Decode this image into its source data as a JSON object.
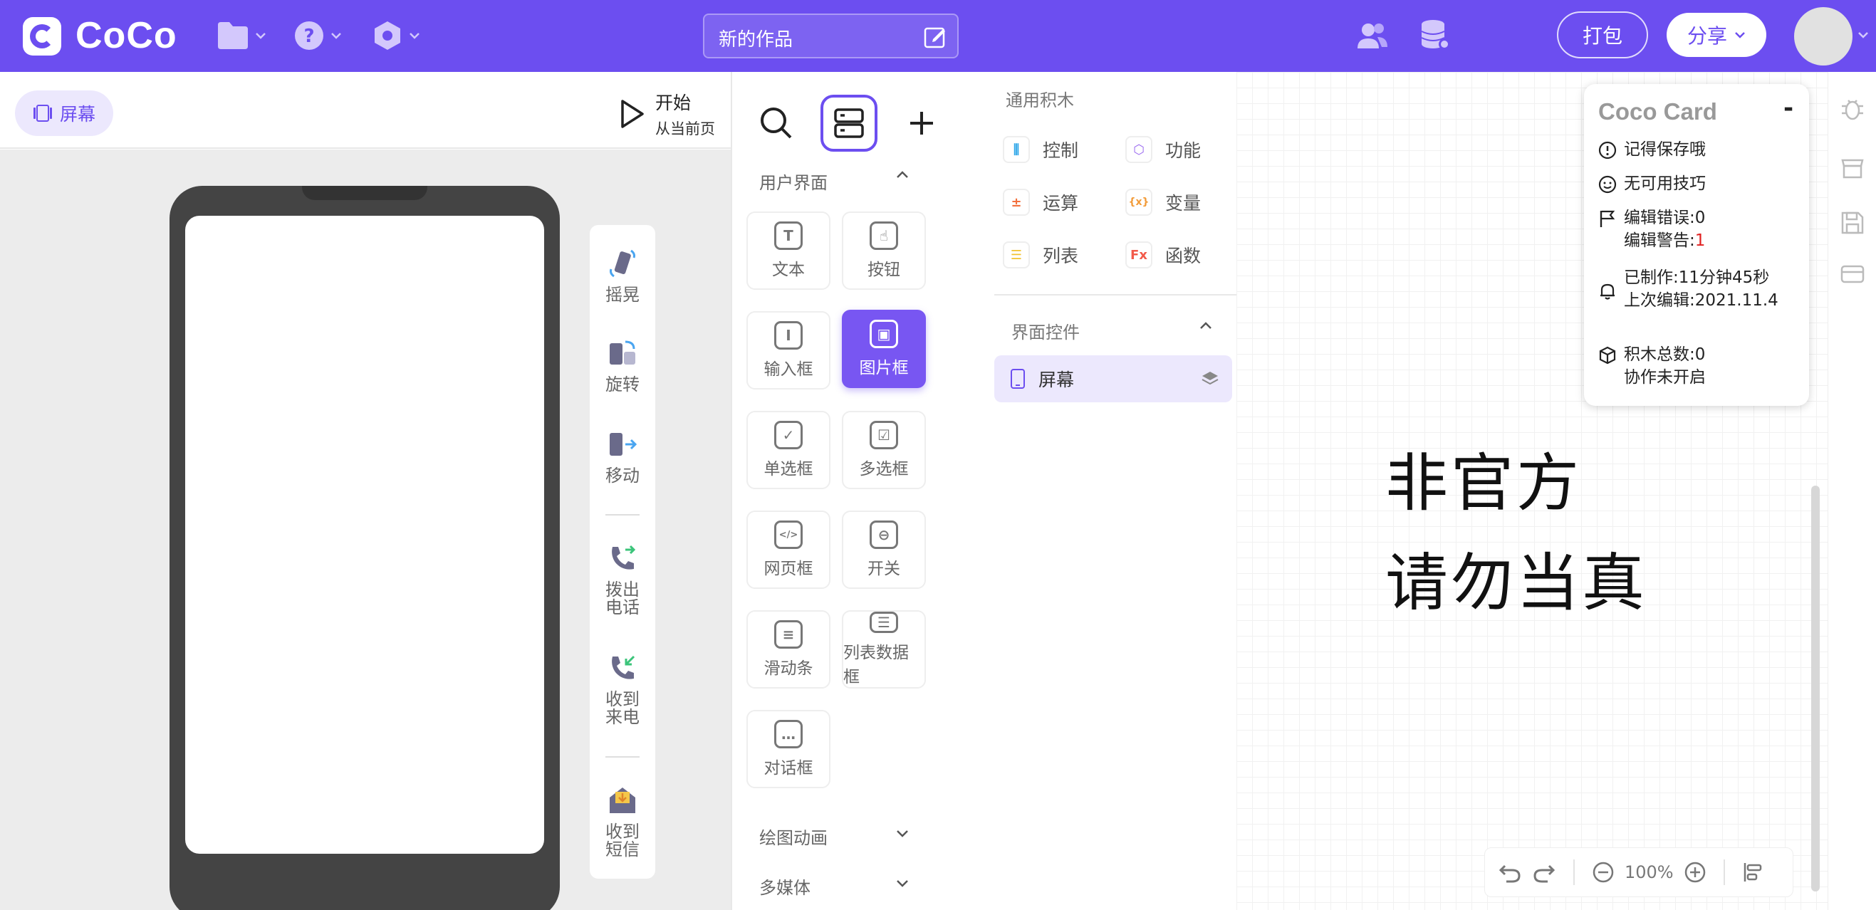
{
  "app": {
    "name": "CoCo"
  },
  "header": {
    "project_title": "新的作品",
    "pack_label": "打包",
    "share_label": "分享",
    "menus": [
      "file-icon",
      "help-icon",
      "settings-icon"
    ]
  },
  "stage": {
    "screen_tab": "屏幕",
    "start_label": "开始",
    "start_sub": "从当前页"
  },
  "sensors": [
    {
      "icon": "shake-icon",
      "label": "摇晃"
    },
    {
      "icon": "rotate-icon",
      "label": "旋转"
    },
    {
      "icon": "move-icon",
      "label": "移动"
    },
    {
      "icon": "call-out-icon",
      "label": "拨出电话"
    },
    {
      "icon": "call-in-icon",
      "label": "收到来电"
    },
    {
      "icon": "sms-icon",
      "label": "收到短信"
    }
  ],
  "components_panel": {
    "category_ui": "用户界面",
    "items": [
      {
        "label": "文本",
        "glyph": "T"
      },
      {
        "label": "按钮",
        "glyph": "☝"
      },
      {
        "label": "输入框",
        "glyph": "I"
      },
      {
        "label": "图片框",
        "glyph": "▣"
      },
      {
        "label": "单选框",
        "glyph": "✓"
      },
      {
        "label": "多选框",
        "glyph": "☑"
      },
      {
        "label": "网页框",
        "glyph": "</>"
      },
      {
        "label": "开关",
        "glyph": "⊖"
      },
      {
        "label": "滑动条",
        "glyph": "≡"
      },
      {
        "label": "列表数据框",
        "glyph": "☰"
      },
      {
        "label": "对话框",
        "glyph": "…"
      }
    ],
    "category_draw": "绘图动画",
    "category_media": "多媒体"
  },
  "blocks": {
    "section_title": "通用积木",
    "categories": [
      {
        "label": "控制",
        "glyph": "⫼",
        "color": "#2aa5e8"
      },
      {
        "label": "功能",
        "glyph": "⬡",
        "color": "#9b6bf0"
      },
      {
        "label": "运算",
        "glyph": "±",
        "color": "#f2703d"
      },
      {
        "label": "变量",
        "glyph": "{x}",
        "color": "#f29b38"
      },
      {
        "label": "列表",
        "glyph": "☰",
        "color": "#f2c230"
      },
      {
        "label": "函数",
        "glyph": "Fx",
        "color": "#f25a4a"
      }
    ],
    "controls_title": "界面控件",
    "screen_control": "屏幕"
  },
  "workspace": {
    "watermark_line1": "非官方",
    "watermark_line2": "请勿当真",
    "zoom": "100%"
  },
  "coco_card": {
    "title": "Coco Card",
    "close": "-",
    "save_hint": "记得保存哦",
    "tips": "无可用技巧",
    "edit_errors": "编辑错误:0",
    "edit_warnings_label": "编辑警告:",
    "edit_warnings_value": "1",
    "made_time": "已制作:11分钟45秒",
    "last_edit": "上次编辑:2021.11.4",
    "block_count": "积木总数:0",
    "collab": "协作未开启"
  }
}
